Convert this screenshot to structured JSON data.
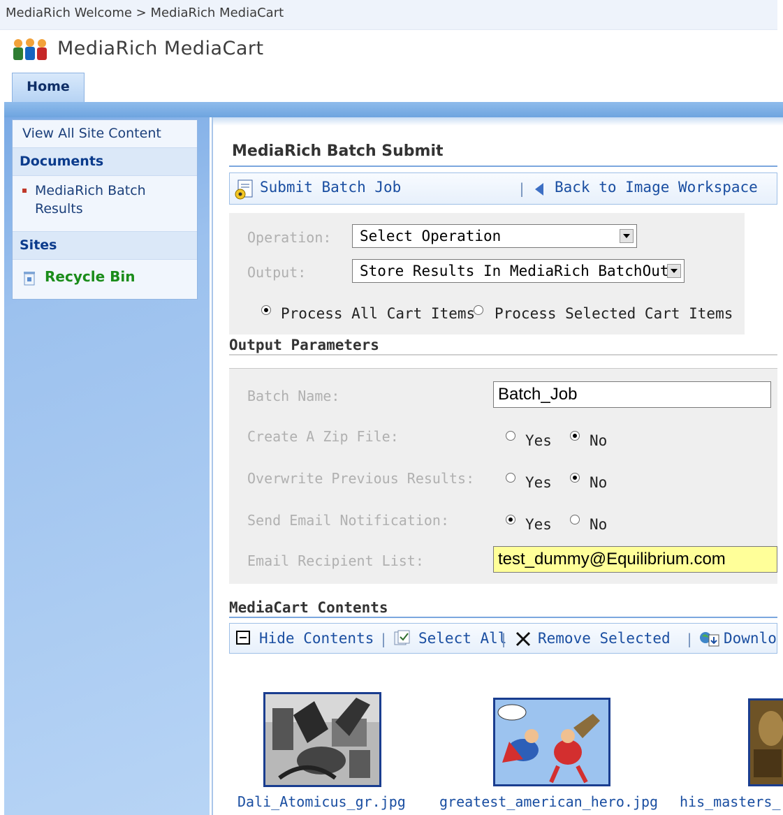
{
  "breadcrumb": "MediaRich Welcome > MediaRich MediaCart",
  "site": {
    "title": "MediaRich MediaCart",
    "logo_icon": "people-icon"
  },
  "tabs": {
    "home": "Home"
  },
  "sidebar": {
    "view_all": "View All Site Content",
    "documents_heading": "Documents",
    "documents_item": "MediaRich Batch Results",
    "sites_heading": "Sites",
    "recycle_bin": "Recycle Bin"
  },
  "web_part": {
    "title": "MediaRich Batch Submit",
    "toolbar": {
      "submit": "Submit Batch Job",
      "separator": "|",
      "back": "Back to Image Workspace"
    },
    "operation_label": "Operation:",
    "operation_value": "Select Operation",
    "output_label": "Output:",
    "output_value": "Store Results In MediaRich BatchOut",
    "process_all": "Process All Cart Items",
    "process_selected": "Process Selected Cart Items",
    "process_mode": "all"
  },
  "output_parameters": {
    "title": "Output Parameters",
    "batch_name_label": "Batch Name:",
    "batch_name_value": "Batch_Job",
    "zip_label": "Create A Zip File:",
    "overwrite_label": "Overwrite Previous Results:",
    "email_notify_label": "Send Email Notification:",
    "email_list_label": "Email Recipient List:",
    "email_list_value": "test_dummy@Equilibrium.com",
    "yes": "Yes",
    "no": "No",
    "zip": "No",
    "overwrite": "No",
    "email_notify": "Yes"
  },
  "cart": {
    "title": "MediaCart Contents",
    "hide": "Hide Contents",
    "select_all": "Select All",
    "remove": "Remove Selected",
    "download": "Downlo",
    "sep": "|",
    "items": [
      "Dali_Atomicus_gr.jpg",
      "greatest_american_hero.jpg",
      "his_masters_"
    ]
  },
  "colors": {
    "link": "#1a4ea1",
    "email_highlight": "#ffff99",
    "nav_blue": "#7aaae5"
  }
}
